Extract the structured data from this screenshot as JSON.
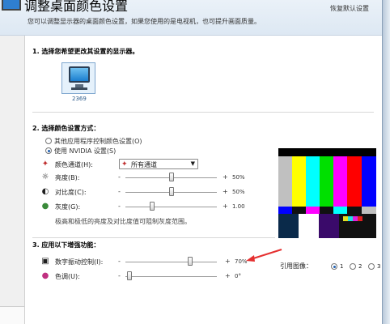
{
  "header": {
    "title": "调整桌面颜色设置",
    "subtitle": "您可以调整显示器的桌面颜色设置，如果您使用的是电视机，也可提升画面质量。",
    "restore_defaults": "恢复默认设置"
  },
  "section1": {
    "title": "1.  选择您希望更改其设置的显示器。",
    "monitor_label": "2369"
  },
  "section2": {
    "title": "2.  选择颜色设置方式：",
    "radio_other": "其他应用程序控制颜色设置(O)",
    "radio_nvidia": "使用 NVIDIA 设置(S)",
    "channel": {
      "label": "颜色通道(H):",
      "selected": "所有通道",
      "icon": "color-channel-icon"
    },
    "sliders": [
      {
        "label": "亮度(B):",
        "value": "50%",
        "level": 0.5,
        "icon": "sun-icon"
      },
      {
        "label": "对比度(C):",
        "value": "50%",
        "level": 0.5,
        "icon": "contrast-icon"
      },
      {
        "label": "灰度(G):",
        "value": "1.00",
        "level": 0.33,
        "icon": "gamma-icon"
      }
    ],
    "note": "极高和极低的亮度及对比度值可阻制灰度范围。",
    "minus": "-",
    "plus": "+"
  },
  "section3": {
    "title": "3.  应用以下增强功能：",
    "sliders": [
      {
        "label": "数字振动控制(I):",
        "value": "70%",
        "level": 0.7,
        "icon": "vibrance-icon"
      },
      {
        "label": "色调(U):",
        "value": "0°",
        "level": 0.0,
        "icon": "hue-icon"
      }
    ],
    "reference_label": "引用图像：",
    "reference_options": [
      "1",
      "2",
      "3"
    ],
    "reference_selected": "1"
  },
  "colors": {
    "accent": "#e53030",
    "selection_bg": "#e5f1fb",
    "header_bg": "#e6eef6"
  }
}
